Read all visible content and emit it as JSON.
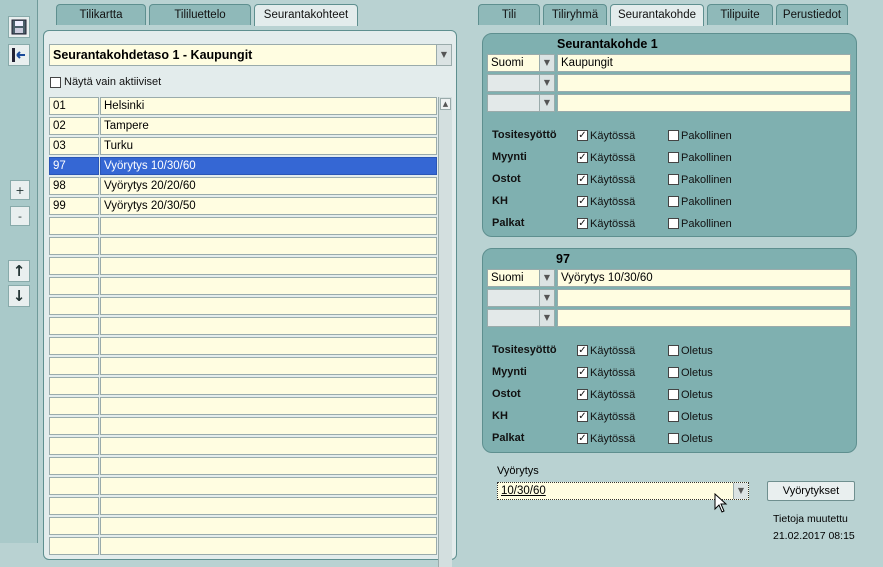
{
  "toolbar": {
    "save_icon": "floppy-disk-icon",
    "exit_icon": "exit-icon",
    "add_label": "+",
    "remove_label": "-",
    "up_label": "↑",
    "down_label": "↓"
  },
  "left_tabs": [
    {
      "label": "Tilikartta",
      "active": false
    },
    {
      "label": "Tililuettelo",
      "active": false
    },
    {
      "label": "Seurantakohteet",
      "active": true
    }
  ],
  "right_tabs": [
    {
      "label": "Tili",
      "active": false
    },
    {
      "label": "Tiliryhmä",
      "active": false
    },
    {
      "label": "Seurantakohde",
      "active": true
    },
    {
      "label": "Tilipuite",
      "active": false
    },
    {
      "label": "Perustiedot",
      "active": false
    }
  ],
  "level_select": {
    "value": "Seurantakohdetaso 1 - Kaupungit"
  },
  "active_only": {
    "label": "Näytä vain aktiiviset",
    "checked": false
  },
  "list": {
    "rows": [
      {
        "code": "01",
        "name": "Helsinki",
        "selected": false
      },
      {
        "code": "02",
        "name": "Tampere",
        "selected": false
      },
      {
        "code": "03",
        "name": "Turku",
        "selected": false
      },
      {
        "code": "97",
        "name": "Vyörytys 10/30/60",
        "selected": true
      },
      {
        "code": "98",
        "name": "Vyörytys 20/20/60",
        "selected": false
      },
      {
        "code": "99",
        "name": "Vyörytys 20/30/50",
        "selected": false
      }
    ],
    "empty_rows": 17
  },
  "group1": {
    "title": "Seurantakohde 1",
    "lang_rows": [
      {
        "lang": "Suomi",
        "text": "Kaupungit"
      },
      {
        "lang": "",
        "text": ""
      },
      {
        "lang": "",
        "text": ""
      }
    ],
    "settings": [
      {
        "label": "Tositesyöttö",
        "enabled": true,
        "enabled_label": "Käytössä",
        "flag": false,
        "flag_label": "Pakollinen"
      },
      {
        "label": "Myynti",
        "enabled": true,
        "enabled_label": "Käytössä",
        "flag": false,
        "flag_label": "Pakollinen"
      },
      {
        "label": "Ostot",
        "enabled": true,
        "enabled_label": "Käytössä",
        "flag": false,
        "flag_label": "Pakollinen"
      },
      {
        "label": "KH",
        "enabled": true,
        "enabled_label": "Käytössä",
        "flag": false,
        "flag_label": "Pakollinen"
      },
      {
        "label": "Palkat",
        "enabled": true,
        "enabled_label": "Käytössä",
        "flag": false,
        "flag_label": "Pakollinen"
      }
    ]
  },
  "group2": {
    "title": "97",
    "lang_rows": [
      {
        "lang": "Suomi",
        "text": "Vyörytys 10/30/60"
      },
      {
        "lang": "",
        "text": ""
      },
      {
        "lang": "",
        "text": ""
      }
    ],
    "settings": [
      {
        "label": "Tositesyöttö",
        "enabled": true,
        "enabled_label": "Käytössä",
        "flag": false,
        "flag_label": "Oletus"
      },
      {
        "label": "Myynti",
        "enabled": true,
        "enabled_label": "Käytössä",
        "flag": false,
        "flag_label": "Oletus"
      },
      {
        "label": "Ostot",
        "enabled": true,
        "enabled_label": "Käytössä",
        "flag": false,
        "flag_label": "Oletus"
      },
      {
        "label": "KH",
        "enabled": true,
        "enabled_label": "Käytössä",
        "flag": false,
        "flag_label": "Oletus"
      },
      {
        "label": "Palkat",
        "enabled": true,
        "enabled_label": "Käytössä",
        "flag": false,
        "flag_label": "Oletus"
      }
    ]
  },
  "allocation": {
    "label": "Vyörytys",
    "value": "10/30/60",
    "button_label": "Vyörytykset"
  },
  "modified": {
    "label": "Tietoja muutettu",
    "date": "21.02.2017 08:15"
  },
  "colors": {
    "background": "#b9d2d2",
    "panel": "#7fb0b0",
    "field": "#fffde1",
    "selection": "#3567d4"
  }
}
